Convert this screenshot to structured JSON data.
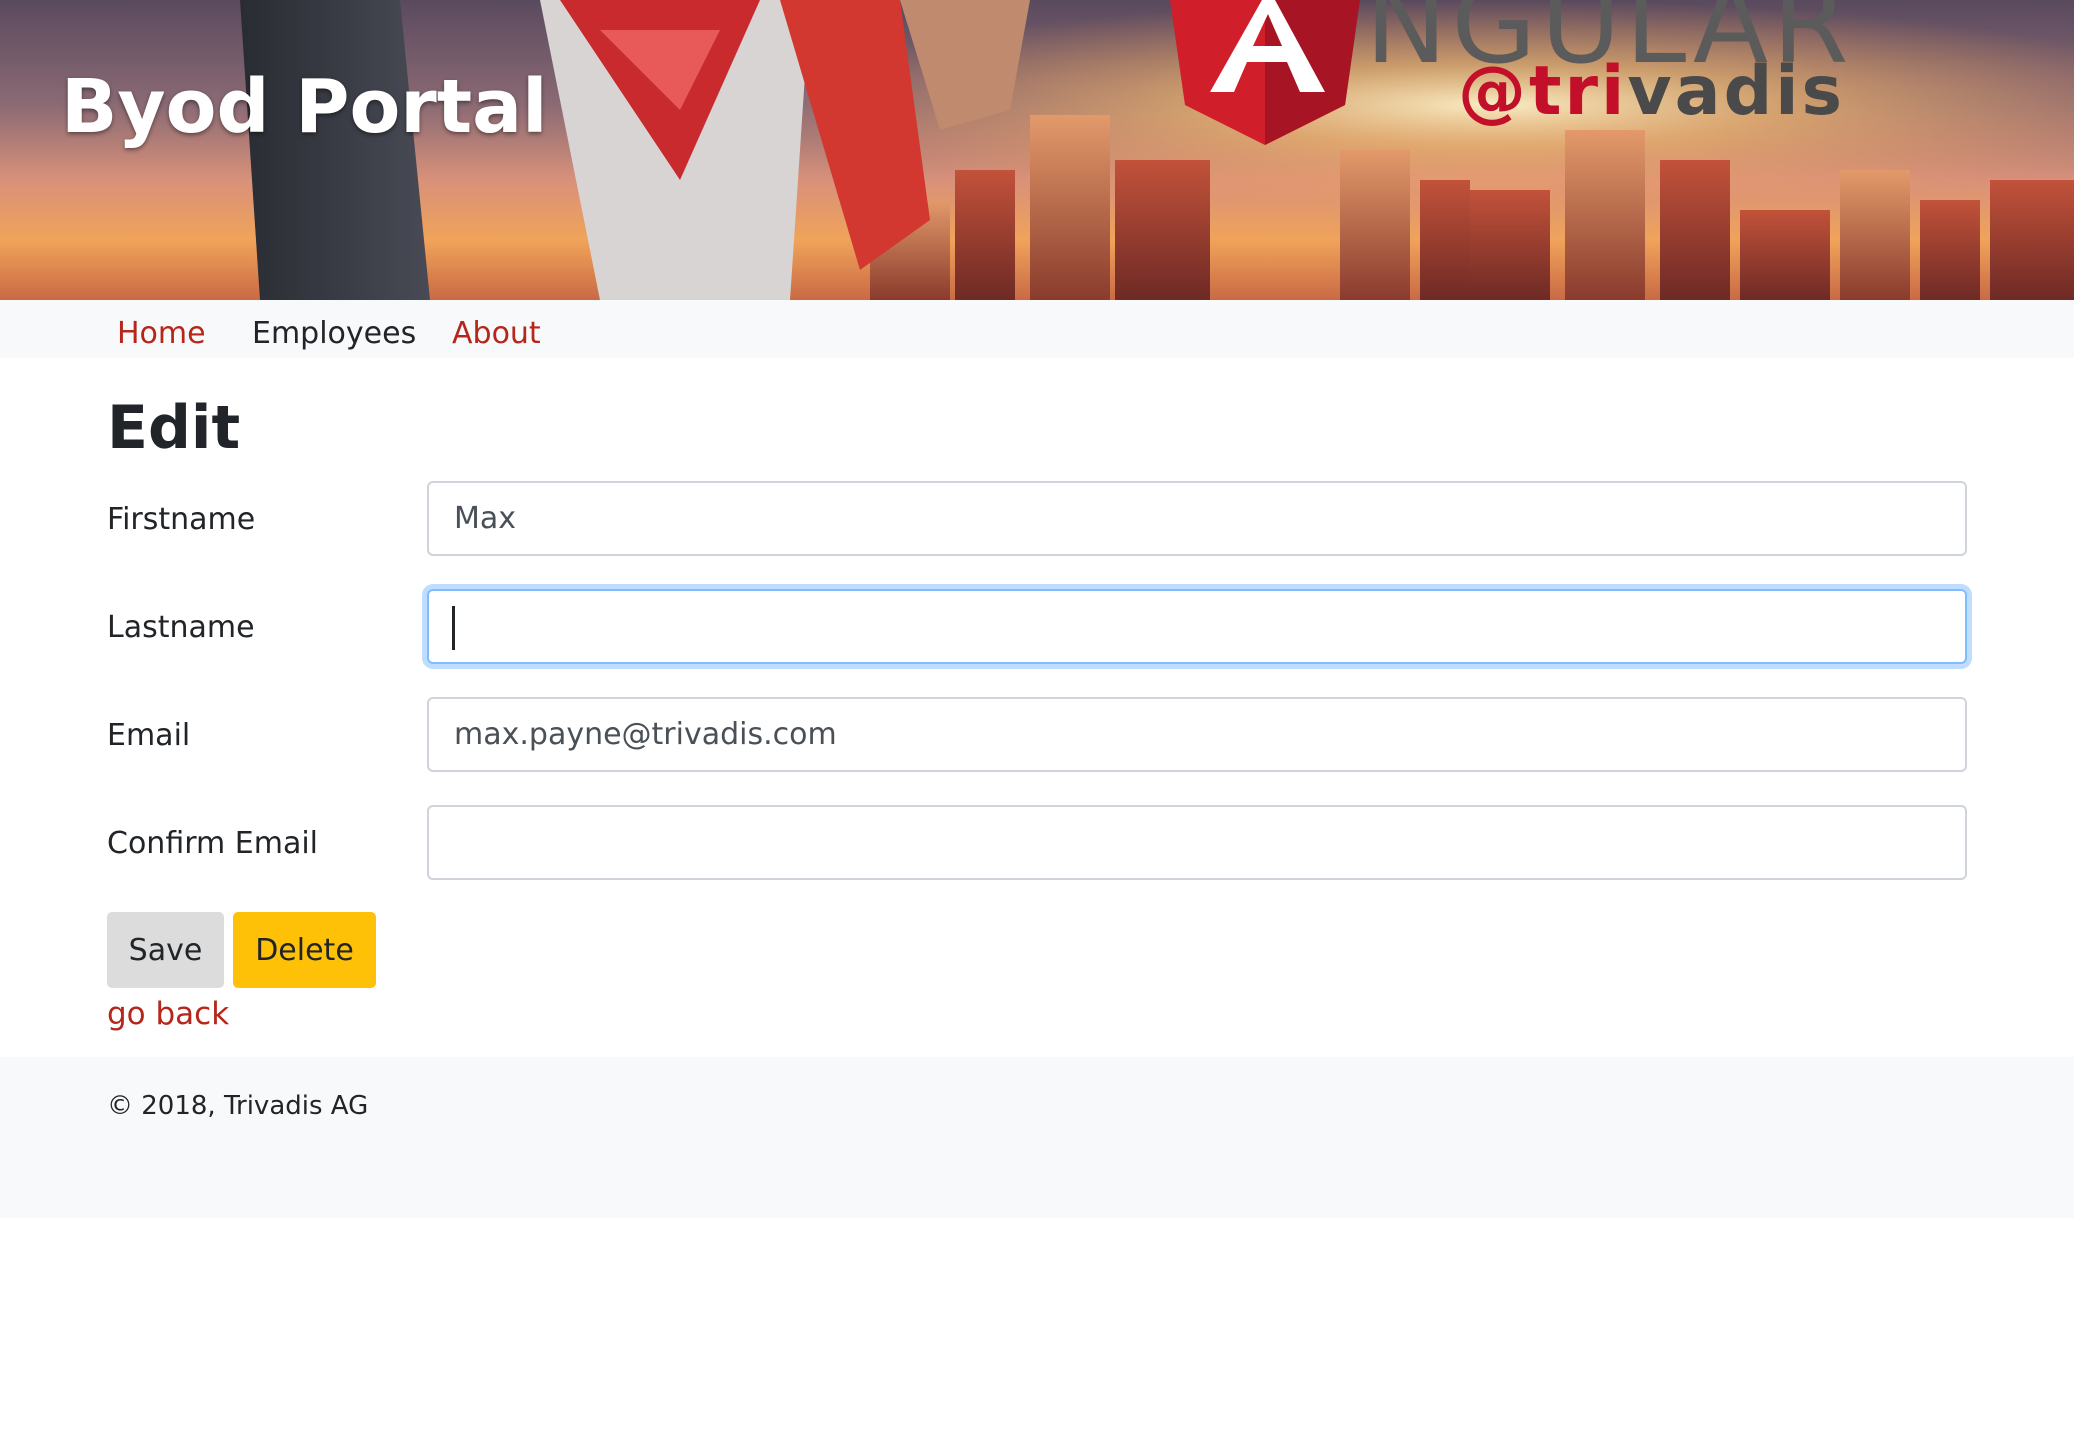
{
  "banner": {
    "title": "Byod Portal",
    "logo_word": "NGULAR",
    "logo_at_prefix": "@",
    "logo_at_red": "tri",
    "logo_at_grey": "vadis"
  },
  "nav": {
    "home": "Home",
    "employees": "Employees",
    "about": "About"
  },
  "main": {
    "title": "Edit",
    "fields": {
      "firstname": {
        "label": "Firstname",
        "value": "Max"
      },
      "lastname": {
        "label": "Lastname",
        "value": ""
      },
      "email": {
        "label": "Email",
        "value": "max.payne@trivadis.com"
      },
      "confirm_email": {
        "label": "Confirm Email",
        "value": ""
      }
    },
    "buttons": {
      "save": "Save",
      "delete": "Delete"
    },
    "go_back": "go back"
  },
  "footer": {
    "text": "© 2018, Trivadis AG"
  },
  "colors": {
    "link": "#b6261b",
    "delete_button": "#ffc107",
    "save_button": "#dcdcdc",
    "focus_border": "#80bdff",
    "nav_background": "#f8f9fa"
  }
}
